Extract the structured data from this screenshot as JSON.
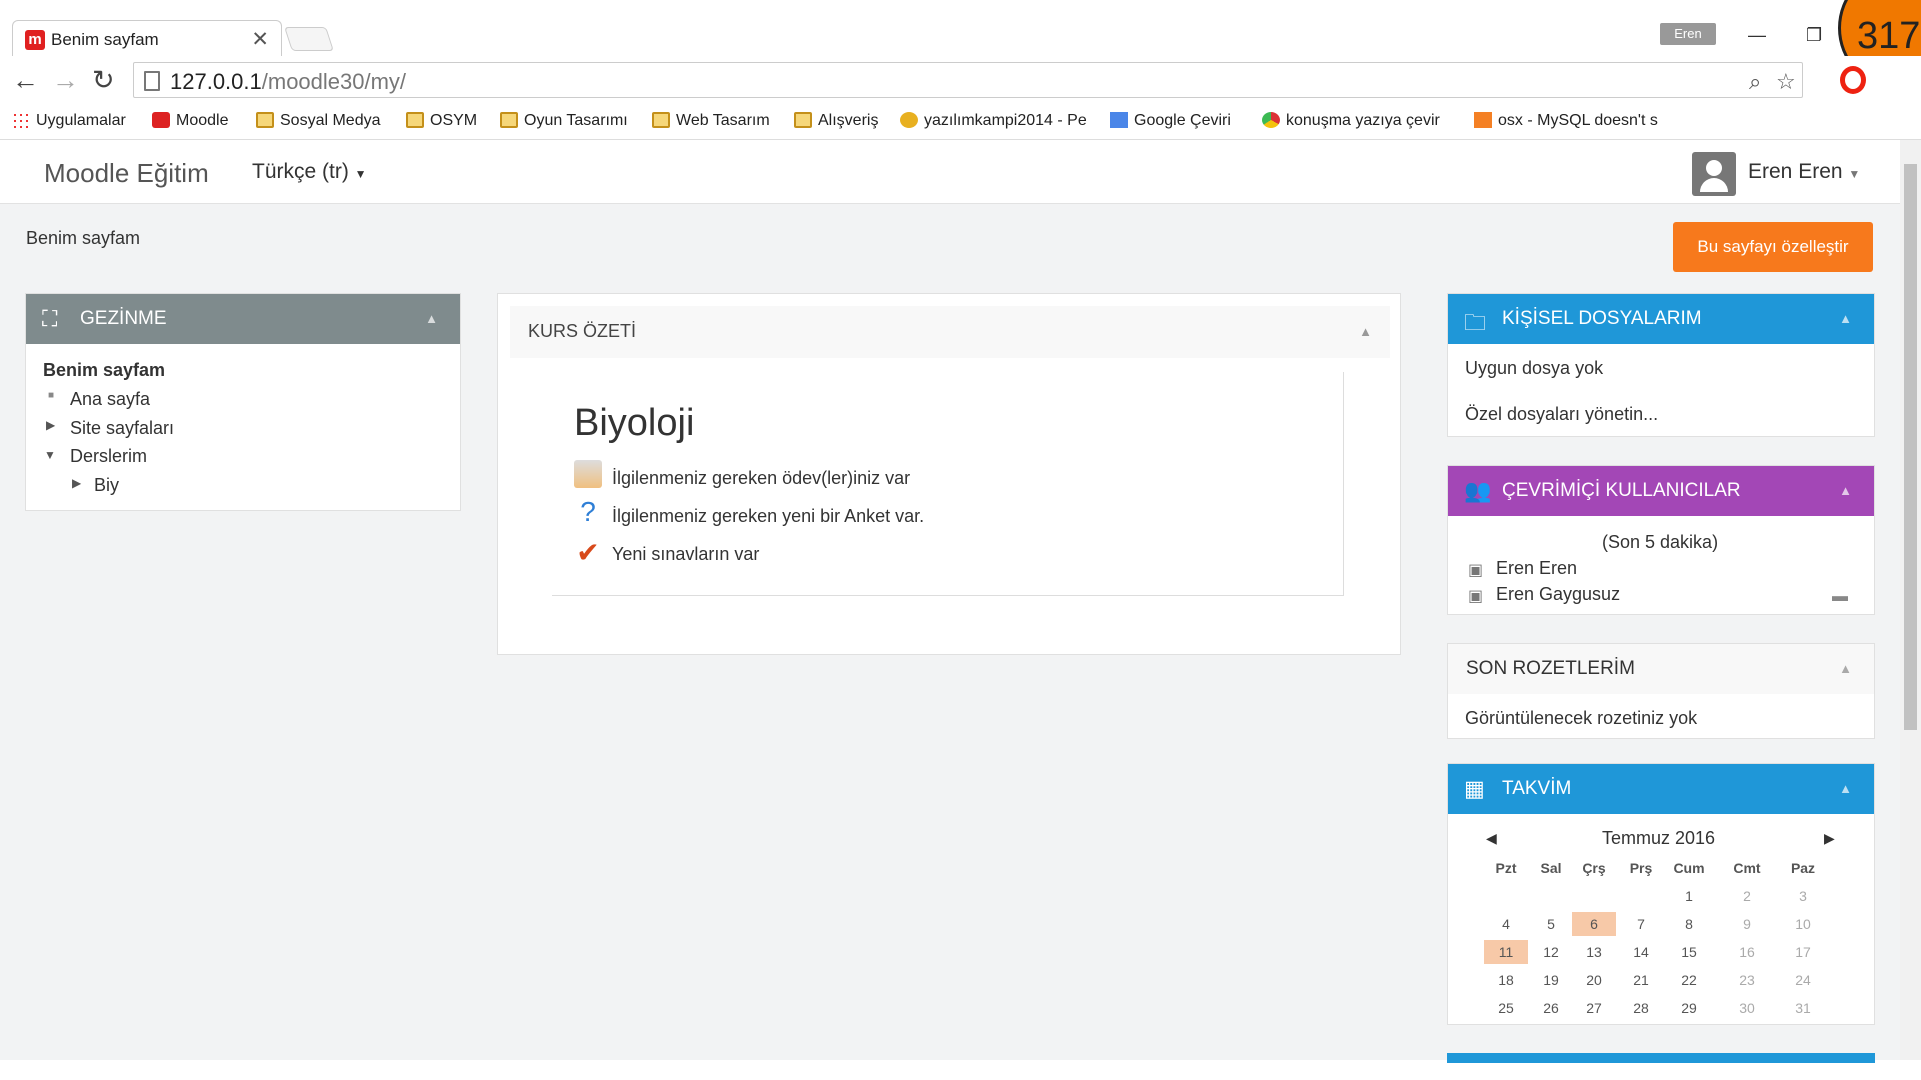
{
  "browser": {
    "tab_title": "Benim sayfam",
    "url_host": "127.0.0.1",
    "url_path": "/moodle30/my/",
    "profile": "Eren",
    "corner_number": "317"
  },
  "bookmarks": [
    "Uygulamalar",
    "Moodle",
    "Sosyal Medya",
    "OSYM",
    "Oyun Tasarımı",
    "Web Tasarım",
    "Alışveriş",
    "yazılımkampi2014 - Pe",
    "Google Çeviri",
    "konuşma yazıya çevir",
    "osx - MySQL doesn't s"
  ],
  "navbar": {
    "brand": "Moodle Eğitim",
    "language": "Türkçe (tr)",
    "user": "Eren Eren"
  },
  "page": {
    "breadcrumb": "Benim sayfam",
    "customize_button": "Bu sayfayı özelleştir"
  },
  "navigation": {
    "title": "GEZİNME",
    "items": [
      "Benim sayfam",
      "Ana sayfa",
      "Site sayfaları",
      "Derslerim",
      "Biy"
    ]
  },
  "course_overview": {
    "title": "KURS ÖZETİ",
    "course": "Biyoloji",
    "notices": [
      "İlgilenmeniz gereken ödev(ler)iniz var",
      "İlgilenmeniz gereken yeni bir Anket var.",
      "Yeni sınavların var"
    ]
  },
  "private_files": {
    "title": "KİŞİSEL DOSYALARIM",
    "empty": "Uygun dosya yok",
    "manage": "Özel dosyaları yönetin..."
  },
  "online_users": {
    "title": "ÇEVRİMİÇİ KULLANICILAR",
    "period": "(Son 5 dakika)",
    "users": [
      "Eren Eren",
      "Eren Gaygusuz"
    ]
  },
  "badges": {
    "title": "SON ROZETLERİM",
    "empty": "Görüntülenecek rozetiniz yok"
  },
  "calendar": {
    "title": "TAKVİM",
    "month": "Temmuz 2016",
    "days": [
      "Pzt",
      "Sal",
      "Çrş",
      "Prş",
      "Cum",
      "Cmt",
      "Paz"
    ],
    "weeks": [
      [
        "",
        "",
        "",
        "",
        "1",
        "2",
        "3"
      ],
      [
        "4",
        "5",
        "6",
        "7",
        "8",
        "9",
        "10"
      ],
      [
        "11",
        "12",
        "13",
        "14",
        "15",
        "16",
        "17"
      ],
      [
        "18",
        "19",
        "20",
        "21",
        "22",
        "23",
        "24"
      ],
      [
        "25",
        "26",
        "27",
        "28",
        "29",
        "30",
        "31"
      ]
    ]
  },
  "colors": {
    "accent_orange": "#f7791c",
    "block_blue": "#1f97d8",
    "block_purple": "#a347b6",
    "block_gray": "#7f8b8d"
  }
}
